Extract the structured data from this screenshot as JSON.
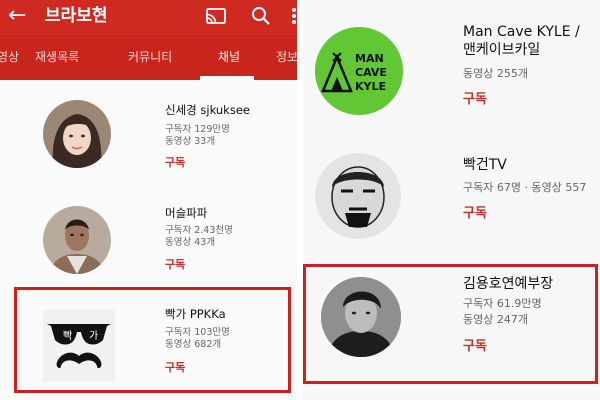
{
  "header": {
    "title": "브라보현",
    "accent_color": "#cf2a21",
    "icons": [
      "back-arrow-icon",
      "cast-icon",
      "search-icon",
      "more-vert-icon"
    ]
  },
  "tabs": [
    {
      "label": "영상"
    },
    {
      "label": "재생목록"
    },
    {
      "label": "커뮤니티"
    },
    {
      "label": "채널",
      "active": true
    },
    {
      "label": "정보"
    }
  ],
  "left_channels": [
    {
      "name": "신세경 sjkuksee",
      "subscribers": "구독자 129만명",
      "videos": "동영상 33개",
      "subscribe_label": "구독"
    },
    {
      "name": "머슬파파",
      "subscribers": "구독자 2.43천명",
      "videos": "동영상 43개",
      "subscribe_label": "구독"
    },
    {
      "name": "빡가 PPKKa",
      "subscribers": "구독자 103만명",
      "videos": "동영상 682개",
      "subscribe_label": "구독",
      "highlighted": true,
      "logo_text_left": "빡",
      "logo_text_right": "가"
    }
  ],
  "right_channels": [
    {
      "name_line1": "Man Cave KYLE /",
      "name_line2": "맨케이브카일",
      "videos": "동영상 255개",
      "subscribe_label": "구독",
      "logo_lines": [
        "MAN",
        "CAVE",
        "KYLE"
      ]
    },
    {
      "name": "빡건TV",
      "meta": "구독자 67명 · 동영상 557",
      "subscribe_label": "구독"
    },
    {
      "name": "김용호연예부장",
      "subscribers": "구독자 61.9만명",
      "videos": "동영상 247개",
      "subscribe_label": "구독",
      "highlighted": true
    }
  ]
}
